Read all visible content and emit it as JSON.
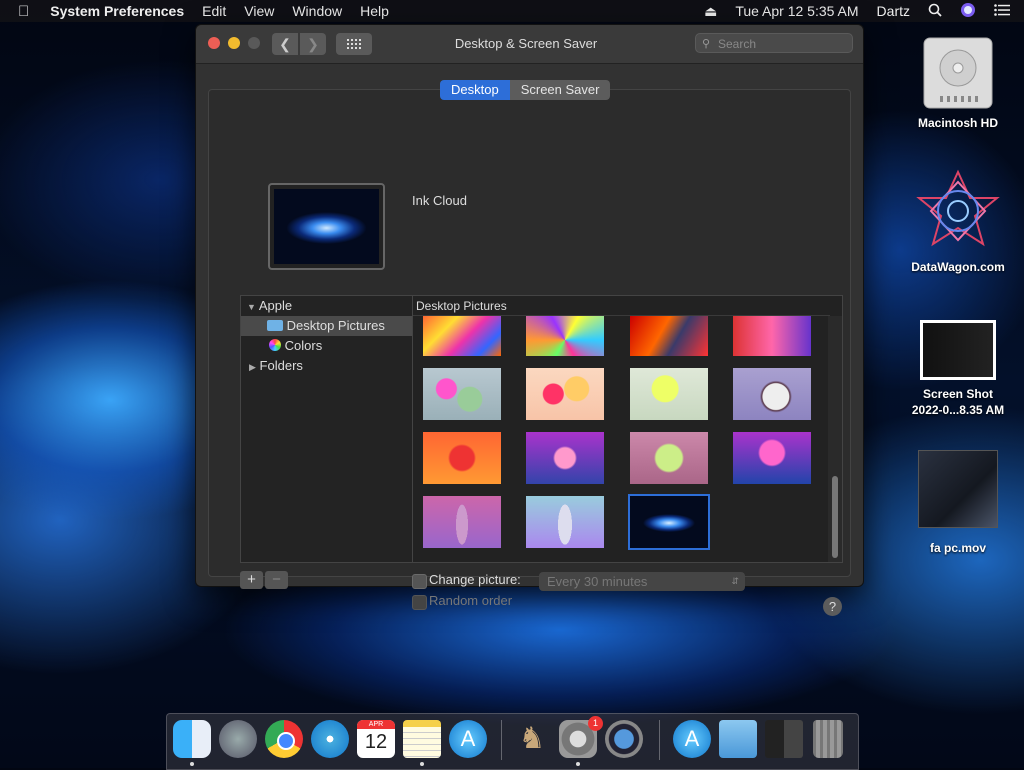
{
  "menubar": {
    "app_name": "System Preferences",
    "menus": [
      "Edit",
      "View",
      "Window",
      "Help"
    ],
    "datetime": "Tue Apr 12  5:35 AM",
    "user": "Dartz"
  },
  "window": {
    "title": "Desktop & Screen Saver",
    "search_placeholder": "Search",
    "tabs": [
      {
        "label": "Desktop",
        "selected": true
      },
      {
        "label": "Screen Saver",
        "selected": false
      }
    ],
    "current_picture": "Ink Cloud",
    "sources": {
      "apple": "Apple",
      "desktop_pictures": "Desktop Pictures",
      "colors": "Colors",
      "folders": "Folders"
    },
    "grid_header": "Desktop Pictures",
    "add_label": "+",
    "remove_label": "−",
    "change_picture_label": "Change picture:",
    "interval": "Every 30 minutes",
    "random_order_label": "Random order",
    "help_label": "?",
    "wallpapers": [
      {
        "name": "colorful-1"
      },
      {
        "name": "colorful-2"
      },
      {
        "name": "colorful-3"
      },
      {
        "name": "colorful-4"
      },
      {
        "name": "shapes-1"
      },
      {
        "name": "shapes-2"
      },
      {
        "name": "shapes-3"
      },
      {
        "name": "shapes-4"
      },
      {
        "name": "flower-1"
      },
      {
        "name": "flower-2"
      },
      {
        "name": "flower-3"
      },
      {
        "name": "flower-4"
      },
      {
        "name": "flower-5"
      },
      {
        "name": "flower-6"
      },
      {
        "name": "ink-cloud",
        "selected": true
      }
    ]
  },
  "desktop_icons": [
    {
      "label": "Macintosh HD"
    },
    {
      "label": "DataWagon.com"
    },
    {
      "label_line1": "Screen Shot",
      "label_line2": "2022-0...8.35 AM"
    },
    {
      "label": "fa pc.mov"
    }
  ],
  "dock": {
    "calendar_month": "APR",
    "calendar_day": "12",
    "system_prefs_badge": "1",
    "apps": [
      "Finder",
      "Launchpad",
      "Google Chrome",
      "Safari",
      "Calendar",
      "Notes",
      "App Store",
      "Chess",
      "System Preferences",
      "QuickTime Player",
      "App Store",
      "Downloads",
      "Screenshot",
      "Trash"
    ]
  }
}
